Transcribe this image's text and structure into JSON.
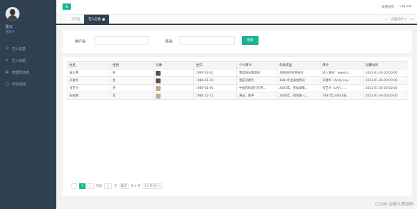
{
  "sidebar": {
    "user_name": "张三",
    "user_role": "管理 ▾",
    "items": [
      {
        "icon": "user-icon",
        "glyph": "⊙",
        "label": "艺人信息"
      },
      {
        "icon": "star-icon",
        "glyph": "✦",
        "label": "艺人动态"
      },
      {
        "icon": "chart-icon",
        "glyph": "▤",
        "label": "管理员动态"
      },
      {
        "icon": "comment-icon",
        "glyph": "◯",
        "label": "评论互动"
      }
    ]
  },
  "topbar": {
    "menu_glyph": "≡",
    "link1": "返回首页",
    "link2": "Log out"
  },
  "tabs": {
    "prev": "«",
    "items": [
      "工作台",
      "艺人信息"
    ],
    "next": "»",
    "more": "页面操作 ▾",
    "fullscreen": "⇥"
  },
  "search": {
    "name_label": "用户名:",
    "name_placeholder": "",
    "alias_label": "姓名:",
    "alias_placeholder": "",
    "button": "搜索"
  },
  "table": {
    "headers": [
      "姓名",
      "性别",
      "头像",
      "生日",
      "个人简介",
      "代表作品",
      "简介",
      "创建时间"
    ],
    "rows": [
      [
        "猫头鹰",
        "男",
        "",
        "1997-02-02",
        "我是猫头鹰源码",
        "本网站所有系统均",
        "进入网站：www.m...",
        "2022-01-26 00:00:00"
      ],
      [
        "刘德华",
        "女",
        "",
        "1986-01-19",
        "我是刘德华",
        "1981年出演电影处",
        "刘德华（Andy Lau...",
        "2022-01-26 00:00:00"
      ],
      [
        "张艺兴",
        "男",
        "",
        "1987-01-06",
        "中国内地流行乐男...",
        "2005年，参加湖南...",
        "张艺兴（LAY），...",
        "2022-01-26 00:00:00"
      ],
      [
        "赵丽颖",
        "女",
        "",
        "1991-12-11",
        "演员、歌手",
        "2006年，回到雅《...",
        "1987年10月16日...",
        "2022-01-26 00:00:00"
      ]
    ]
  },
  "pager": {
    "prev": "‹",
    "page": "1",
    "next": "›",
    "goto_label": "到第",
    "goto_value": "1",
    "page_unit": "页",
    "confirm": "确定",
    "total": "共 4 条",
    "page_size": "10 条/页 ▾"
  },
  "watermark": "CSDN @猫头鹰源码",
  "colors": {
    "accent": "#1ab394",
    "sidebar": "#2f4050"
  }
}
